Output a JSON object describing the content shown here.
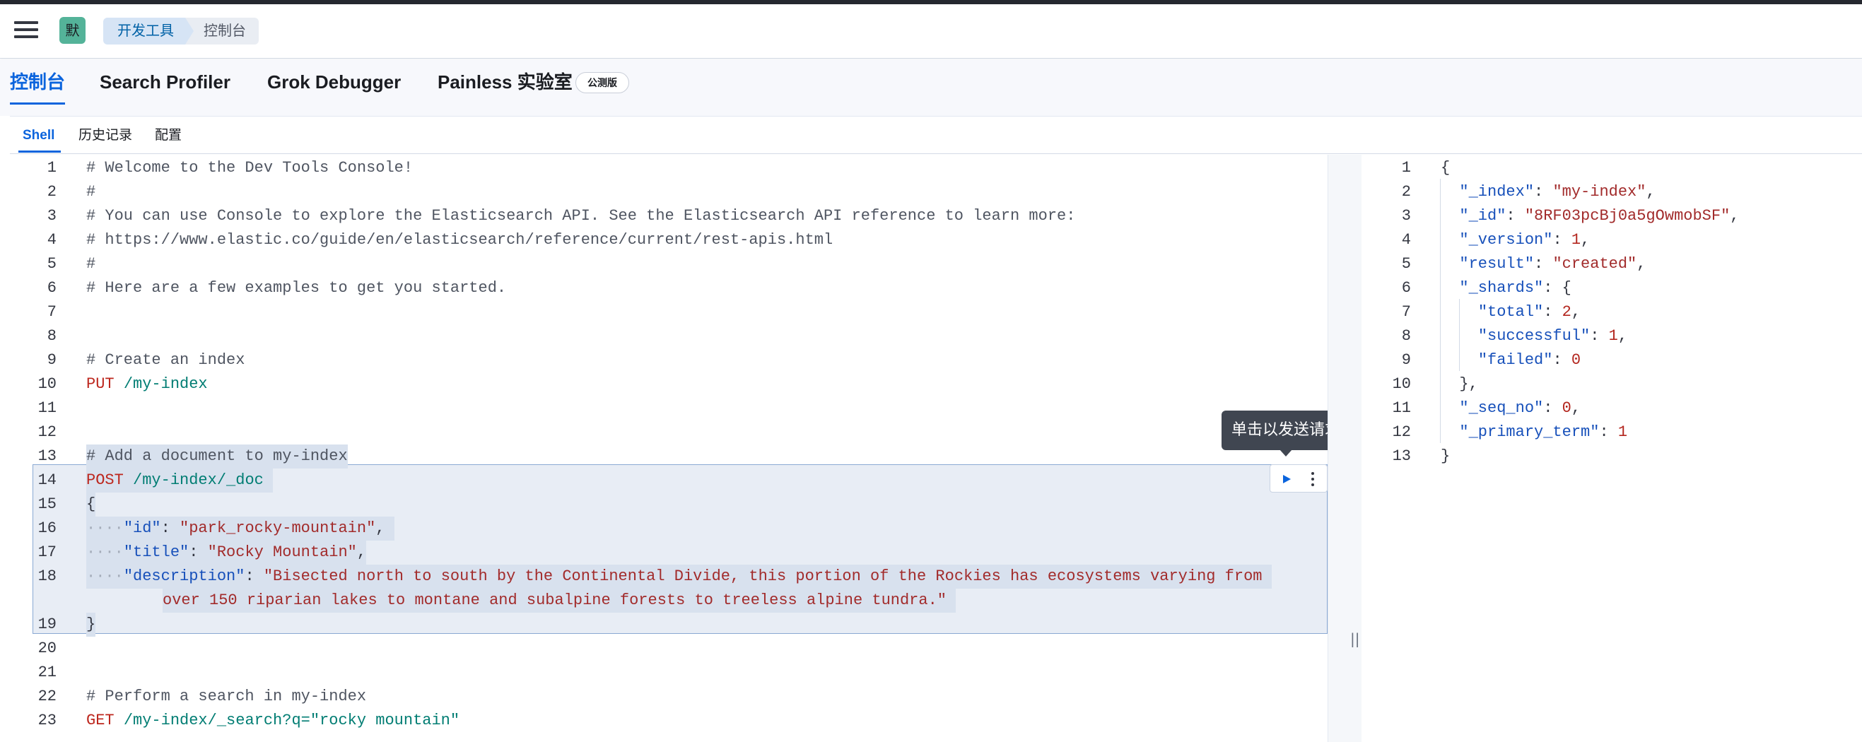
{
  "header": {
    "avatar_letter": "默",
    "breadcrumbs": [
      "开发工具",
      "控制台"
    ]
  },
  "tabs": [
    {
      "label": "控制台",
      "active": true
    },
    {
      "label": "Search Profiler",
      "active": false
    },
    {
      "label": "Grok Debugger",
      "active": false
    },
    {
      "label": "Painless 实验室",
      "active": false
    }
  ],
  "beta_badge": "公测版",
  "subtabs": [
    {
      "label": "Shell",
      "active": true
    },
    {
      "label": "历史记录",
      "active": false
    },
    {
      "label": "配置",
      "active": false
    }
  ],
  "tooltip": "单击以发送请求",
  "editor": {
    "line_numbers": [
      "1",
      "2",
      "3",
      "4",
      "5",
      "6",
      "7",
      "8",
      "9",
      "10",
      "11",
      "12",
      "13",
      "14",
      "15",
      "16",
      "17",
      "18",
      "19",
      "20",
      "21",
      "22",
      "23"
    ],
    "lines": [
      "# Welcome to the Dev Tools Console!",
      "#",
      "# You can use Console to explore the Elasticsearch API. See the Elasticsearch API reference to learn more:",
      "# https://www.elastic.co/guide/en/elasticsearch/reference/current/rest-apis.html",
      "#",
      "# Here are a few examples to get you started.",
      "",
      "",
      "# Create an index",
      "",
      "",
      "",
      "# Add a document to my-index",
      "",
      "{",
      "",
      "",
      "",
      "}",
      "",
      "",
      "# Perform a search in my-index",
      ""
    ],
    "methods": {
      "put": "PUT",
      "post": "POST",
      "get": "GET"
    },
    "paths": {
      "put": "/my-index",
      "post": "/my-index/_doc",
      "get": "/my-index/_search?q=\"rocky mountain\""
    },
    "doc_fields": {
      "id_key": "\"id\"",
      "id_val": "\"park_rocky-mountain\"",
      "title_key": "\"title\"",
      "title_val": "\"Rocky Mountain\"",
      "desc_key": "\"description\"",
      "desc_val_1": "\"Bisected north to south by the Continental Divide, this portion of the Rockies has ecosystems varying from",
      "desc_val_2": "over 150 riparian lakes to montane and subalpine forests to treeless alpine tundra.\""
    }
  },
  "output": {
    "line_numbers": [
      "1",
      "2",
      "3",
      "4",
      "5",
      "6",
      "7",
      "8",
      "9",
      "10",
      "11",
      "12",
      "13"
    ],
    "fields": {
      "index_key": "\"_index\"",
      "index_val": "\"my-index\"",
      "id_key": "\"_id\"",
      "id_val": "\"8RF03pcBj0a5gOwmobSF\"",
      "version_key": "\"_version\"",
      "version_val": "1",
      "result_key": "\"result\"",
      "result_val": "\"created\"",
      "shards_key": "\"_shards\"",
      "total_key": "\"total\"",
      "total_val": "2",
      "successful_key": "\"successful\"",
      "successful_val": "1",
      "failed_key": "\"failed\"",
      "failed_val": "0",
      "seq_key": "\"_seq_no\"",
      "seq_val": "0",
      "term_key": "\"_primary_term\"",
      "term_val": "1"
    }
  }
}
